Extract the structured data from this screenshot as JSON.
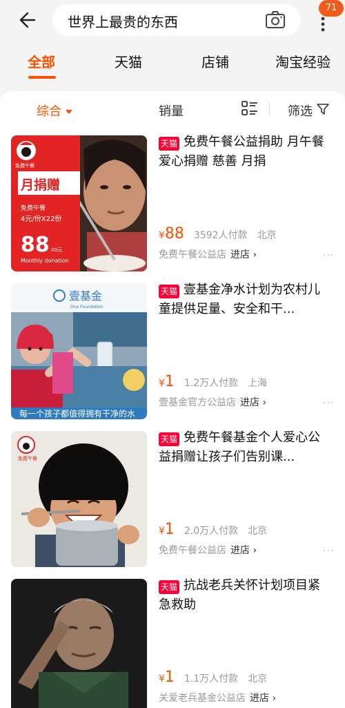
{
  "header": {
    "search_query": "世界上最贵的东西",
    "notification_count": "71"
  },
  "tabs": [
    {
      "label": "全部"
    },
    {
      "label": "天猫"
    },
    {
      "label": "店铺"
    },
    {
      "label": "淘宝经验"
    }
  ],
  "sort": {
    "comprehensive": "综合",
    "sales": "销量",
    "filter": "筛选"
  },
  "currency_symbol": "¥",
  "enter_shop": "进店 ›",
  "more": "···",
  "products": [
    {
      "tag": "天猫",
      "title": "免费午餐公益捐助 月午餐 爱心捐赠 慈善 月捐",
      "price": "88",
      "sales": "3592人付款",
      "city": "北京",
      "shop": "免费午餐公益店",
      "image_text": {
        "banner": "月捐赠",
        "logo": "免费午餐",
        "subtitle": "免费午餐",
        "detail": "4元/份X22份",
        "amount": "88",
        "unit": "00元",
        "footer": "Monthly donation"
      }
    },
    {
      "tag": "天猫",
      "title": "壹基金净水计划为农村儿童提供足量、安全和干...",
      "price": "1",
      "sales": "1.2万人付款",
      "city": "上海",
      "shop": "壹基金官方公益店",
      "image_text": {
        "logo": "壹基金",
        "logo_en": "One Foundation",
        "caption": "每一个孩子都值得拥有干净的水"
      }
    },
    {
      "tag": "天猫",
      "title": "免费午餐基金个人爱心公益捐赠让孩子们告别课...",
      "price": "1",
      "sales": "2.0万人付款",
      "city": "北京",
      "shop": "免费午餐公益店",
      "image_text": {
        "logo": "免费午餐"
      }
    },
    {
      "tag": "天猫",
      "title": "抗战老兵关怀计划项目紧急救助",
      "price": "1",
      "sales": "1.1万人付款",
      "city": "北京",
      "shop": "关爱老兵基金公益店"
    }
  ],
  "colors": {
    "accent": "#ff5000",
    "tmall": "#ff0036",
    "badge": "#f25a1c"
  }
}
